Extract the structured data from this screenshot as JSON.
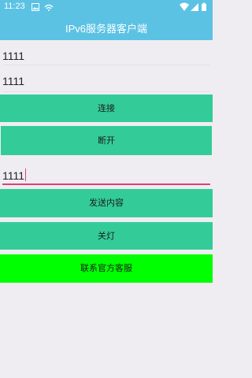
{
  "status_bar": {
    "time": "11:23",
    "icons": [
      "image-icon",
      "notification-icon",
      "wifi-icon",
      "cellular-signal-icon",
      "battery-icon"
    ]
  },
  "app_bar": {
    "title": "IPv6服务器客户端"
  },
  "inputs": {
    "address_value": "1111",
    "port_value": "1111",
    "message_value": "1111"
  },
  "buttons": {
    "connect": "连接",
    "disconnect": "断开",
    "send": "发送内容",
    "lights_off": "关灯",
    "contact_support": "联系官方客服"
  },
  "colors": {
    "app_bar": "#5bc2e4",
    "button": "#33cc98",
    "support_button": "#00ff00",
    "accent": "#e0407a",
    "background": "#efedf1"
  }
}
